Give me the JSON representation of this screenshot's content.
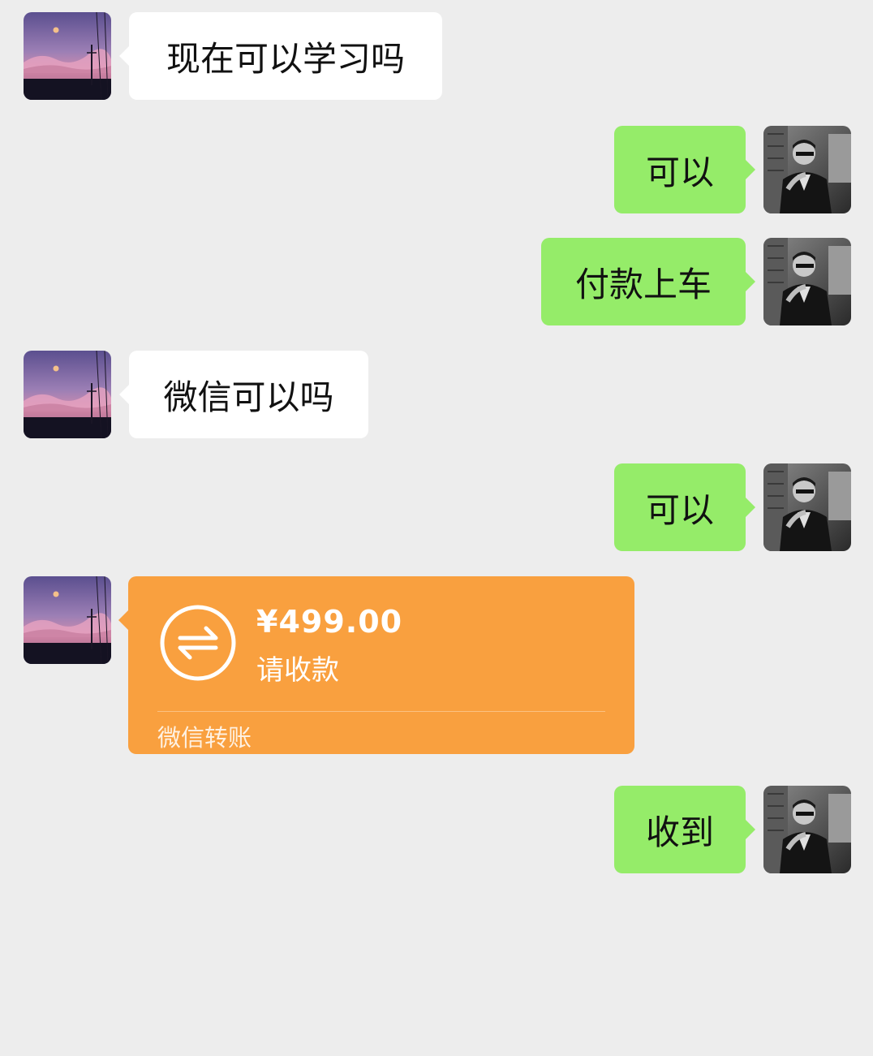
{
  "messages": [
    {
      "direction": "in",
      "text": "现在可以学习吗"
    },
    {
      "direction": "out",
      "text": "可以"
    },
    {
      "direction": "out",
      "text": "付款上车"
    },
    {
      "direction": "in",
      "text": "微信可以吗"
    },
    {
      "direction": "out",
      "text": "可以"
    },
    {
      "direction": "in",
      "type": "transfer",
      "amount": "¥499.00",
      "status": "请收款",
      "footer": "微信转账"
    },
    {
      "direction": "out",
      "text": "收到"
    }
  ],
  "colors": {
    "background": "#ededed",
    "incoming_bubble": "#ffffff",
    "outgoing_bubble": "#95ec69",
    "transfer_card": "#f9a03f"
  },
  "icons": {
    "transfer": "transfer-arrows-icon",
    "contact_avatar": "sunset-landscape-avatar",
    "self_avatar": "man-portrait-avatar"
  }
}
